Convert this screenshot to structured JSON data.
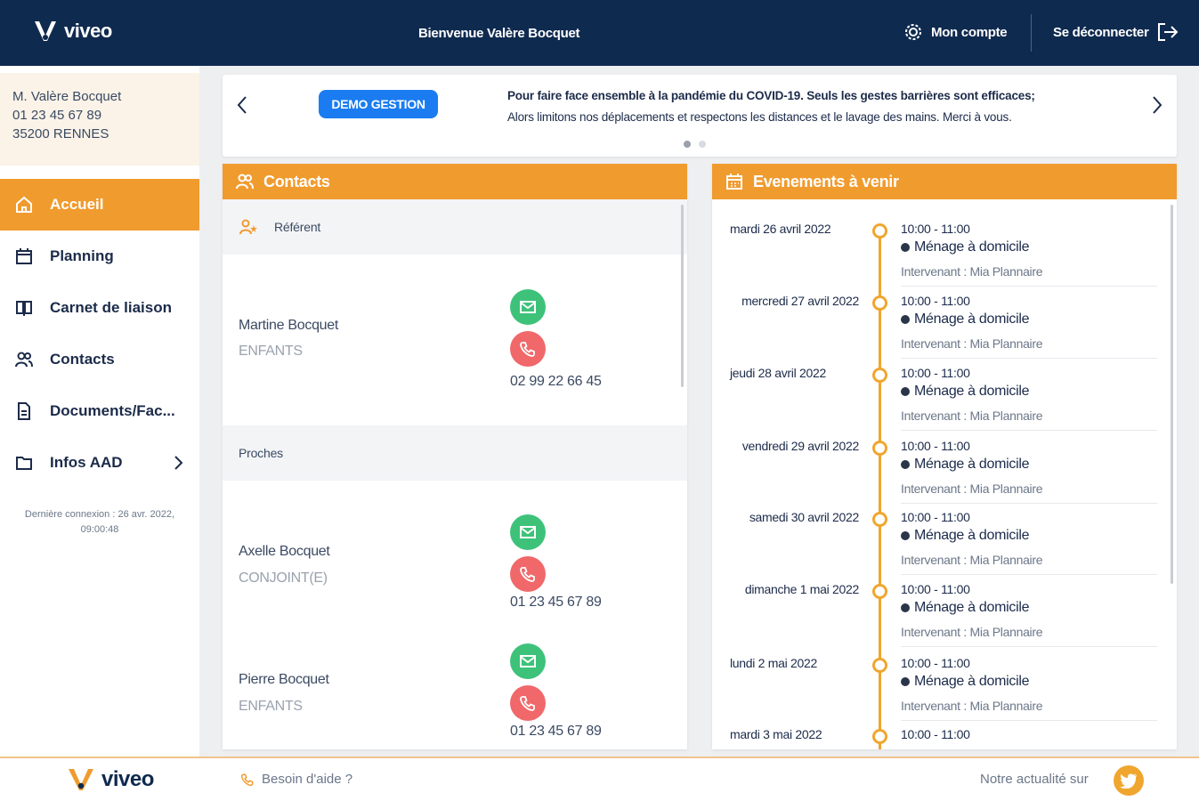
{
  "header": {
    "brand": "viveo",
    "welcome": "Bienvenue Valère Bocquet",
    "account_label": "Mon compte",
    "logout_label": "Se déconnecter"
  },
  "user": {
    "name": "M. Valère Bocquet",
    "phone": "01 23 45 67 89",
    "city": "35200 RENNES"
  },
  "sidebar": {
    "items": [
      {
        "label": "Accueil",
        "icon": "home-icon",
        "active": true
      },
      {
        "label": "Planning",
        "icon": "calendar-icon"
      },
      {
        "label": "Carnet de liaison",
        "icon": "book-icon"
      },
      {
        "label": "Contacts",
        "icon": "users-icon"
      },
      {
        "label": "Documents/Fac...",
        "icon": "document-icon"
      },
      {
        "label": "Infos AAD",
        "icon": "folder-icon"
      }
    ],
    "last_login": "Dernière connexion : 26 avr. 2022, 09:00:48"
  },
  "banner": {
    "badge": "DEMO GESTION",
    "text_bold": "Pour faire face ensemble à la pandémie du COVID-19. Seuls les gestes barrières sont efficaces;",
    "text_rest": "Alors limitons nos déplacements et respectons les distances et le lavage des mains. Merci à vous."
  },
  "contacts": {
    "title": "Contacts",
    "referent_label": "Référent",
    "proches_label": "Proches",
    "items": [
      {
        "name": "Martine Bocquet",
        "role": "ENFANTS",
        "phone": "02 99 22 66 45"
      },
      {
        "name": "Axelle Bocquet",
        "role": "CONJOINT(E)",
        "phone": "01 23 45 67 89"
      },
      {
        "name": "Pierre Bocquet",
        "role": "ENFANTS",
        "phone": "01 23 45 67 89"
      }
    ]
  },
  "events": {
    "title": "Evenements à venir",
    "items": [
      {
        "date": "mardi 26 avril 2022",
        "time": "10:00 - 11:00",
        "title": "Ménage à domicile",
        "who": "Intervenant : Mia Plannaire"
      },
      {
        "date": "mercredi 27 avril 2022",
        "time": "10:00 - 11:00",
        "title": "Ménage à domicile",
        "who": "Intervenant : Mia Plannaire"
      },
      {
        "date": "jeudi 28 avril 2022",
        "time": "10:00 - 11:00",
        "title": "Ménage à domicile",
        "who": "Intervenant : Mia Plannaire"
      },
      {
        "date": "vendredi 29 avril 2022",
        "time": "10:00 - 11:00",
        "title": "Ménage à domicile",
        "who": "Intervenant : Mia Plannaire"
      },
      {
        "date": "samedi 30 avril 2022",
        "time": "10:00 - 11:00",
        "title": "Ménage à domicile",
        "who": "Intervenant : Mia Plannaire"
      },
      {
        "date": "dimanche 1 mai 2022",
        "time": "10:00 - 11:00",
        "title": "Ménage à domicile",
        "who": "Intervenant : Mia Plannaire"
      },
      {
        "date": "lundi 2 mai 2022",
        "time": "10:00 - 11:00",
        "title": "Ménage à domicile",
        "who": "Intervenant : Mia Plannaire"
      },
      {
        "date": "mardi 3 mai 2022",
        "time": "10:00 - 11:00",
        "title": "",
        "who": ""
      }
    ]
  },
  "footer": {
    "brand": "viveo",
    "help": "Besoin d'aide ?",
    "news": "Notre actualité sur"
  },
  "colors": {
    "navy": "#0f2a4f",
    "orange": "#f09b2e",
    "blue_badge": "#1a7cf0",
    "green": "#3ec27a",
    "red": "#f0686a"
  }
}
